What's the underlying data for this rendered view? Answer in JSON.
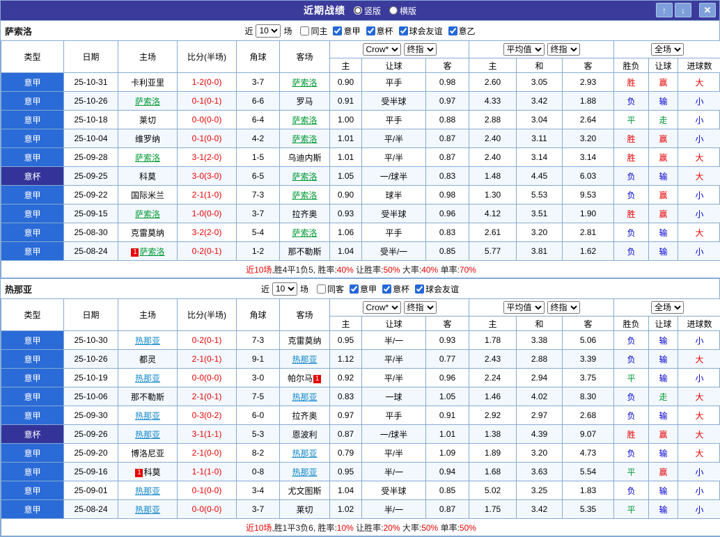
{
  "colors": {
    "titlebar_bg": "#3b3b9b",
    "serie_a_cell_bg": "#2b6bd7",
    "cup_cell_bg": "#333399",
    "win_red": "#e60000",
    "lose_blue": "#0000cc",
    "draw_green": "#009933",
    "team1_link": "#009933",
    "team2_link": "#0e86c8",
    "grid_border": "#85aad4"
  },
  "header": {
    "title": "近期战绩",
    "layout_options": [
      {
        "label": "竖版",
        "selected": true
      },
      {
        "label": "横版",
        "selected": false
      }
    ],
    "up_button": "↑",
    "down_button": "↓",
    "close_button": "✕"
  },
  "table_headers": {
    "type": "类型",
    "date": "日期",
    "home": "主场",
    "score": "比分(半场)",
    "corner": "角球",
    "away": "客场",
    "sub": {
      "o_h": "主",
      "o_hd": "让球",
      "o_a": "客",
      "a_h": "主",
      "a_d": "和",
      "a_a": "客",
      "res": "胜负",
      "hres": "让球",
      "goals": "进球数"
    }
  },
  "sections": [
    {
      "team": "萨索洛",
      "filter": {
        "near": "近",
        "count": "10",
        "games": "场",
        "checkboxes": [
          {
            "label": "同主",
            "checked": false
          },
          {
            "label": "意甲",
            "checked": true
          },
          {
            "label": "意杯",
            "checked": true
          },
          {
            "label": "球会友谊",
            "checked": true
          },
          {
            "label": "意乙",
            "checked": true
          }
        ]
      },
      "controls": {
        "odds_source": "Crow*",
        "odds_stage": "终指",
        "avg": "平均值",
        "avg_stage": "终指",
        "scope": "全场"
      },
      "rows": [
        {
          "lg": "意甲",
          "date": "25-10-31",
          "h": "卡利亚里",
          "a": "萨索洛",
          "ac": "tg",
          "score": "1-2(0-0)",
          "cor": "3-7",
          "o1": "0.90",
          "hd": "平手",
          "o2": "0.98",
          "m1": "2.60",
          "m2": "3.05",
          "m3": "2.93",
          "r1": "胜",
          "r1c": "r",
          "r2": "赢",
          "r2c": "r",
          "r3": "大",
          "r3c": "r"
        },
        {
          "lg": "意甲",
          "date": "25-10-26",
          "h": "萨索洛",
          "hc": "tg",
          "a": "罗马",
          "score": "0-1(0-1)",
          "cor": "6-6",
          "o1": "0.91",
          "hd": "受半球",
          "o2": "0.97",
          "m1": "4.33",
          "m2": "3.42",
          "m3": "1.88",
          "r1": "负",
          "r1c": "b",
          "r2": "输",
          "r2c": "b",
          "r3": "小",
          "r3c": "b"
        },
        {
          "lg": "意甲",
          "date": "25-10-18",
          "h": "莱切",
          "a": "萨索洛",
          "ac": "tg",
          "score": "0-0(0-0)",
          "cor": "6-4",
          "o1": "1.00",
          "hd": "平手",
          "o2": "0.88",
          "m1": "2.88",
          "m2": "3.04",
          "m3": "2.64",
          "r1": "平",
          "r1c": "g",
          "r2": "走",
          "r2c": "g",
          "r3": "小",
          "r3c": "b"
        },
        {
          "lg": "意甲",
          "date": "25-10-04",
          "h": "维罗纳",
          "a": "萨索洛",
          "ac": "tg",
          "score": "0-1(0-0)",
          "cor": "4-2",
          "o1": "1.01",
          "hd": "平/半",
          "o2": "0.87",
          "m1": "2.40",
          "m2": "3.11",
          "m3": "3.20",
          "r1": "胜",
          "r1c": "r",
          "r2": "赢",
          "r2c": "r",
          "r3": "小",
          "r3c": "b"
        },
        {
          "lg": "意甲",
          "date": "25-09-28",
          "h": "萨索洛",
          "hc": "tg",
          "a": "乌迪内斯",
          "score": "3-1(2-0)",
          "cor": "1-5",
          "o1": "1.01",
          "hd": "平/半",
          "o2": "0.87",
          "m1": "2.40",
          "m2": "3.14",
          "m3": "3.14",
          "r1": "胜",
          "r1c": "r",
          "r2": "赢",
          "r2c": "r",
          "r3": "大",
          "r3c": "r"
        },
        {
          "lg": "意杯",
          "lgC": "lgc",
          "date": "25-09-25",
          "h": "科莫",
          "a": "萨索洛",
          "ac": "tg",
          "score": "3-0(3-0)",
          "cor": "6-5",
          "o1": "1.05",
          "hd": "一/球半",
          "o2": "0.83",
          "m1": "1.48",
          "m2": "4.45",
          "m3": "6.03",
          "r1": "负",
          "r1c": "b",
          "r2": "输",
          "r2c": "b",
          "r3": "大",
          "r3c": "r"
        },
        {
          "lg": "意甲",
          "date": "25-09-22",
          "h": "国际米兰",
          "a": "萨索洛",
          "ac": "tg",
          "score": "2-1(1-0)",
          "cor": "7-3",
          "o1": "0.90",
          "hd": "球半",
          "o2": "0.98",
          "m1": "1.30",
          "m2": "5.53",
          "m3": "9.53",
          "r1": "负",
          "r1c": "b",
          "r2": "赢",
          "r2c": "r",
          "r3": "小",
          "r3c": "b"
        },
        {
          "lg": "意甲",
          "date": "25-09-15",
          "h": "萨索洛",
          "hc": "tg",
          "a": "拉齐奥",
          "score": "1-0(0-0)",
          "cor": "3-7",
          "o1": "0.93",
          "hd": "受半球",
          "o2": "0.96",
          "m1": "4.12",
          "m2": "3.51",
          "m3": "1.90",
          "r1": "胜",
          "r1c": "r",
          "r2": "赢",
          "r2c": "r",
          "r3": "小",
          "r3c": "b"
        },
        {
          "lg": "意甲",
          "date": "25-08-30",
          "h": "克雷莫纳",
          "a": "萨索洛",
          "ac": "tg",
          "score": "3-2(2-0)",
          "cor": "5-4",
          "o1": "1.06",
          "hd": "平手",
          "o2": "0.83",
          "m1": "2.61",
          "m2": "3.20",
          "m3": "2.81",
          "r1": "负",
          "r1c": "b",
          "r2": "输",
          "r2c": "b",
          "r3": "大",
          "r3c": "r"
        },
        {
          "lg": "意甲",
          "date": "25-08-24",
          "hbb": "1",
          "h": "萨索洛",
          "hc": "tg",
          "a": "那不勒斯",
          "score": "0-2(0-1)",
          "cor": "1-2",
          "o1": "1.04",
          "hd": "受半/一",
          "o2": "0.85",
          "m1": "5.77",
          "m2": "3.81",
          "m3": "1.62",
          "r1": "负",
          "r1c": "b",
          "r2": "输",
          "r2c": "b",
          "r3": "小",
          "r3c": "b"
        }
      ],
      "summary": [
        {
          "t": "近10场",
          "c": "r"
        },
        {
          "t": ",胜4平1负5, 胜率:",
          "c": "k"
        },
        {
          "t": "40%",
          "c": "r"
        },
        {
          "t": " 让胜率:",
          "c": "k"
        },
        {
          "t": "50%",
          "c": "r"
        },
        {
          "t": " 大率:",
          "c": "k"
        },
        {
          "t": "40%",
          "c": "r"
        },
        {
          "t": " 单率:",
          "c": "k"
        },
        {
          "t": "70%",
          "c": "r"
        }
      ]
    },
    {
      "team": "热那亚",
      "filter": {
        "near": "近",
        "count": "10",
        "games": "场",
        "checkboxes": [
          {
            "label": "同客",
            "checked": false
          },
          {
            "label": "意甲",
            "checked": true
          },
          {
            "label": "意杯",
            "checked": true
          },
          {
            "label": "球会友谊",
            "checked": true
          }
        ]
      },
      "controls": {
        "odds_source": "Crow*",
        "odds_stage": "终指",
        "avg": "平均值",
        "avg_stage": "终指",
        "scope": "全场"
      },
      "rows": [
        {
          "lg": "意甲",
          "date": "25-10-30",
          "h": "热那亚",
          "hc": "tb",
          "a": "克雷莫纳",
          "score": "0-2(0-1)",
          "cor": "7-3",
          "o1": "0.95",
          "hd": "半/一",
          "o2": "0.93",
          "m1": "1.78",
          "m2": "3.38",
          "m3": "5.06",
          "r1": "负",
          "r1c": "b",
          "r2": "输",
          "r2c": "b",
          "r3": "小",
          "r3c": "b"
        },
        {
          "lg": "意甲",
          "date": "25-10-26",
          "h": "都灵",
          "a": "热那亚",
          "ac": "tb",
          "score": "2-1(0-1)",
          "cor": "9-1",
          "o1": "1.12",
          "hd": "平/半",
          "o2": "0.77",
          "m1": "2.43",
          "m2": "2.88",
          "m3": "3.39",
          "r1": "负",
          "r1c": "b",
          "r2": "输",
          "r2c": "b",
          "r3": "大",
          "r3c": "r"
        },
        {
          "lg": "意甲",
          "date": "25-10-19",
          "h": "热那亚",
          "hc": "tb",
          "a": "帕尔马",
          "aba": "1",
          "score": "0-0(0-0)",
          "cor": "3-0",
          "o1": "0.92",
          "hd": "平/半",
          "o2": "0.96",
          "m1": "2.24",
          "m2": "2.94",
          "m3": "3.75",
          "r1": "平",
          "r1c": "g",
          "r2": "输",
          "r2c": "b",
          "r3": "小",
          "r3c": "b"
        },
        {
          "lg": "意甲",
          "date": "25-10-06",
          "h": "那不勒斯",
          "a": "热那亚",
          "ac": "tb",
          "score": "2-1(0-1)",
          "cor": "7-5",
          "o1": "0.83",
          "hd": "一球",
          "o2": "1.05",
          "m1": "1.46",
          "m2": "4.02",
          "m3": "8.30",
          "r1": "负",
          "r1c": "b",
          "r2": "走",
          "r2c": "g",
          "r3": "大",
          "r3c": "r"
        },
        {
          "lg": "意甲",
          "date": "25-09-30",
          "h": "热那亚",
          "hc": "tb",
          "a": "拉齐奥",
          "score": "0-3(0-2)",
          "cor": "6-0",
          "o1": "0.97",
          "hd": "平手",
          "o2": "0.91",
          "m1": "2.92",
          "m2": "2.97",
          "m3": "2.68",
          "r1": "负",
          "r1c": "b",
          "r2": "输",
          "r2c": "b",
          "r3": "大",
          "r3c": "r"
        },
        {
          "lg": "意杯",
          "lgC": "lgc",
          "date": "25-09-26",
          "h": "热那亚",
          "hc": "tb",
          "a": "恩波利",
          "score": "3-1(1-1)",
          "cor": "5-3",
          "o1": "0.87",
          "hd": "一/球半",
          "o2": "1.01",
          "m1": "1.38",
          "m2": "4.39",
          "m3": "9.07",
          "r1": "胜",
          "r1c": "r",
          "r2": "赢",
          "r2c": "r",
          "r3": "大",
          "r3c": "r"
        },
        {
          "lg": "意甲",
          "date": "25-09-20",
          "h": "博洛尼亚",
          "a": "热那亚",
          "ac": "tb",
          "score": "2-1(0-0)",
          "cor": "8-2",
          "o1": "0.79",
          "hd": "平/半",
          "o2": "1.09",
          "m1": "1.89",
          "m2": "3.20",
          "m3": "4.73",
          "r1": "负",
          "r1c": "b",
          "r2": "输",
          "r2c": "b",
          "r3": "大",
          "r3c": "r"
        },
        {
          "lg": "意甲",
          "date": "25-09-16",
          "hbb": "1",
          "h": "科莫",
          "a": "热那亚",
          "ac": "tb",
          "score": "1-1(1-0)",
          "cor": "0-8",
          "o1": "0.95",
          "hd": "半/一",
          "o2": "0.94",
          "m1": "1.68",
          "m2": "3.63",
          "m3": "5.54",
          "r1": "平",
          "r1c": "g",
          "r2": "赢",
          "r2c": "r",
          "r3": "小",
          "r3c": "b"
        },
        {
          "lg": "意甲",
          "date": "25-09-01",
          "h": "热那亚",
          "hc": "tb",
          "a": "尤文图斯",
          "score": "0-1(0-0)",
          "cor": "3-4",
          "o1": "1.04",
          "hd": "受半球",
          "o2": "0.85",
          "m1": "5.02",
          "m2": "3.25",
          "m3": "1.83",
          "r1": "负",
          "r1c": "b",
          "r2": "输",
          "r2c": "b",
          "r3": "小",
          "r3c": "b"
        },
        {
          "lg": "意甲",
          "date": "25-08-24",
          "h": "热那亚",
          "hc": "tb",
          "a": "莱切",
          "score": "0-0(0-0)",
          "cor": "3-7",
          "o1": "1.02",
          "hd": "半/一",
          "o2": "0.87",
          "m1": "1.75",
          "m2": "3.42",
          "m3": "5.35",
          "r1": "平",
          "r1c": "g",
          "r2": "输",
          "r2c": "b",
          "r3": "小",
          "r3c": "b"
        }
      ],
      "summary": [
        {
          "t": "近10场",
          "c": "r"
        },
        {
          "t": ",胜1平3负6, 胜率:",
          "c": "k"
        },
        {
          "t": "10%",
          "c": "r"
        },
        {
          "t": " 让胜率:",
          "c": "k"
        },
        {
          "t": "20%",
          "c": "r"
        },
        {
          "t": " 大率:",
          "c": "k"
        },
        {
          "t": "50%",
          "c": "r"
        },
        {
          "t": " 单率:",
          "c": "k"
        },
        {
          "t": "50%",
          "c": "r"
        }
      ]
    }
  ]
}
